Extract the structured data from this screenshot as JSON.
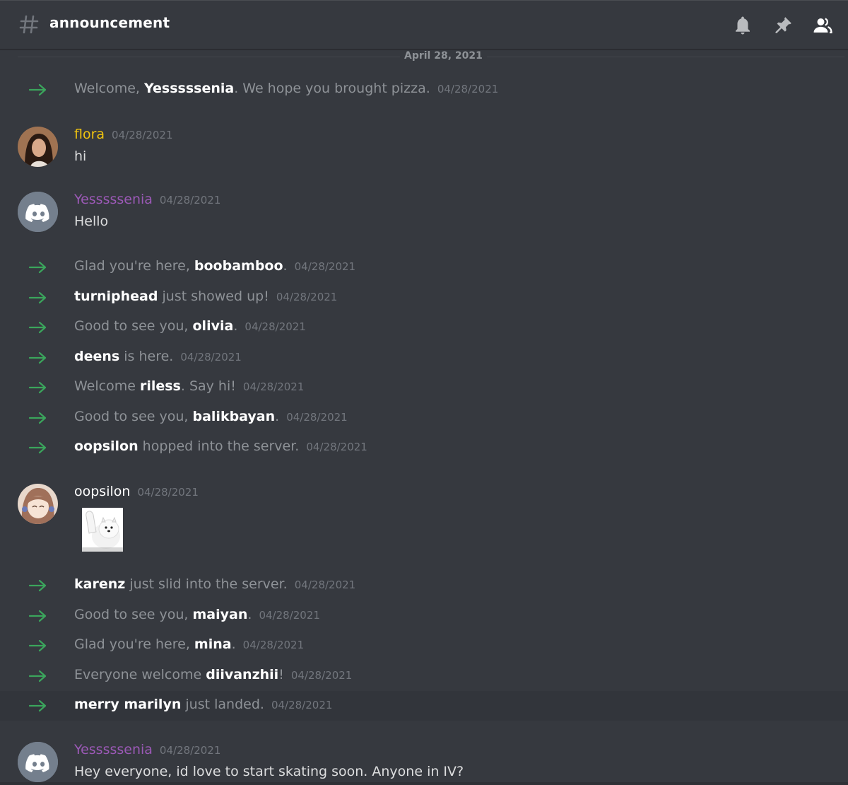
{
  "header": {
    "channel_name": "announcement",
    "icons": [
      "hash-icon",
      "bell-icon",
      "pin-icon",
      "members-icon"
    ]
  },
  "divider": {
    "date": "April 28, 2021"
  },
  "colors": {
    "flora": "#f1c40f",
    "yesssssenia": "#9b59b6",
    "default_user": "#ffffff",
    "system_text": "#8e9297",
    "arrow": "#3ba55c",
    "background": "#36393f"
  },
  "messages": [
    {
      "type": "system",
      "pre": "Welcome, ",
      "name": "Yesssssenia",
      "post": ". We hope you brought pizza.",
      "ts": "04/28/2021"
    },
    {
      "type": "user",
      "author": "flora",
      "ts": "04/28/2021",
      "content": "hi",
      "avatar": "photo"
    },
    {
      "type": "user",
      "author": "Yesssssenia",
      "ts": "04/28/2021",
      "content": "Hello",
      "avatar": "discord-logo"
    },
    {
      "type": "system",
      "pre": "Glad you're here, ",
      "name": "boobamboo",
      "post": ".",
      "ts": "04/28/2021"
    },
    {
      "type": "system",
      "pre": "",
      "name": "turniphead",
      "post": " just showed up!",
      "ts": "04/28/2021"
    },
    {
      "type": "system",
      "pre": "Good to see you, ",
      "name": "olivia",
      "post": ".",
      "ts": "04/28/2021"
    },
    {
      "type": "system",
      "pre": "",
      "name": "deens",
      "post": " is here.",
      "ts": "04/28/2021"
    },
    {
      "type": "system",
      "pre": "Welcome ",
      "name": "riless",
      "post": ". Say hi!",
      "ts": "04/28/2021"
    },
    {
      "type": "system",
      "pre": "Good to see you, ",
      "name": "balikbayan",
      "post": ".",
      "ts": "04/28/2021"
    },
    {
      "type": "system",
      "pre": "",
      "name": "oopsilon",
      "post": " hopped into the server.",
      "ts": "04/28/2021"
    },
    {
      "type": "user",
      "author": "oopsilon",
      "ts": "04/28/2021",
      "content": "",
      "avatar": "anime",
      "sticker": "waving-dog-sticker"
    },
    {
      "type": "system",
      "pre": "",
      "name": "karenz",
      "post": " just slid into the server.",
      "ts": "04/28/2021"
    },
    {
      "type": "system",
      "pre": "Good to see you, ",
      "name": "maiyan",
      "post": ".",
      "ts": "04/28/2021"
    },
    {
      "type": "system",
      "pre": "Glad you're here, ",
      "name": "mina",
      "post": ".",
      "ts": "04/28/2021"
    },
    {
      "type": "system",
      "pre": "Everyone welcome ",
      "name": "diivanzhii",
      "post": "!",
      "ts": "04/28/2021"
    },
    {
      "type": "system",
      "pre": "",
      "name": "merry marilyn",
      "post": " just landed.",
      "ts": "04/28/2021"
    },
    {
      "type": "user",
      "author": "Yesssssenia",
      "ts": "04/28/2021",
      "content": "Hey everyone, id love to start skating soon. Anyone in IV?",
      "avatar": "discord-logo"
    }
  ]
}
